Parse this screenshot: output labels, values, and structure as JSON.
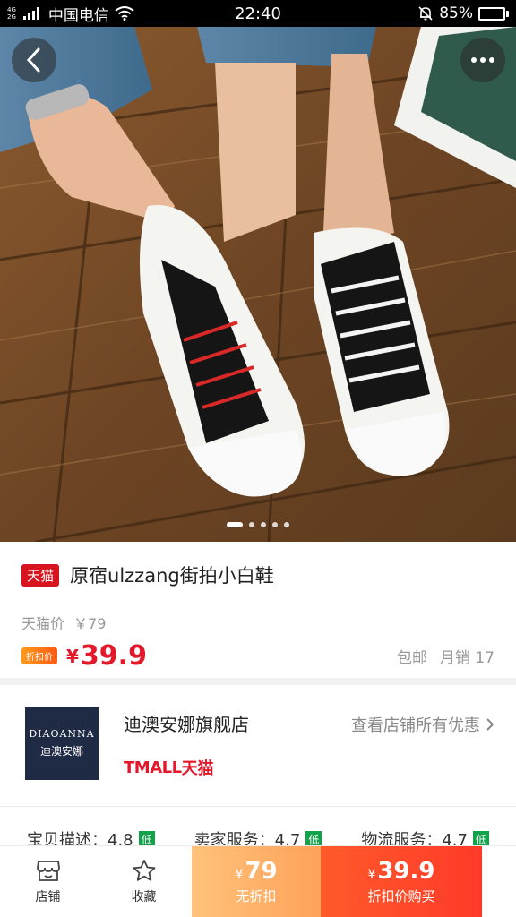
{
  "status_bar": {
    "net_top": "4G",
    "net_bottom": "2G",
    "carrier": "中国电信",
    "time": "22:40",
    "battery": "85%",
    "battery_level": 0.85,
    "battery_color": "#39d353"
  },
  "hero": {
    "back_icon": "chevron-left-icon",
    "more_icon": "more-dots-icon",
    "image_count": 5,
    "active_index": 0
  },
  "product": {
    "tmall_badge": "天猫",
    "title": "原宿ulzzang街拍小白鞋",
    "orig_label": "天猫价",
    "orig_price": "￥79",
    "discount_badge": "折扣价",
    "yen": "¥",
    "price": "39.9",
    "shipping": "包邮",
    "monthly_sales": "月销 17"
  },
  "shop": {
    "logo_en": "DIAOANNA",
    "logo_cn": "迪澳安娜",
    "name": "迪澳安娜旗舰店",
    "brand_latin": "TMALL",
    "brand_cn": "天猫",
    "link": "查看店铺所有优惠",
    "link_icon": "chevron-right-icon"
  },
  "ratings": [
    {
      "label": "宝贝描述：4.8",
      "badge": "低"
    },
    {
      "label": "卖家服务：4.7",
      "badge": "低"
    },
    {
      "label": "物流服务：4.7",
      "badge": "低"
    }
  ],
  "bottom_bar": {
    "shop_label": "店铺",
    "shop_icon": "store-icon",
    "fav_label": "收藏",
    "fav_icon": "star-icon",
    "buy_full_yen": "¥",
    "buy_full_price": "79",
    "buy_full_label": "无折扣",
    "buy_disc_yen": "¥",
    "buy_disc_price": "39.9",
    "buy_disc_label": "折扣价购买"
  },
  "colors": {
    "accent_red": "#e4182a",
    "tmall_red": "#d8141e",
    "low_badge_green": "#12a24a"
  }
}
